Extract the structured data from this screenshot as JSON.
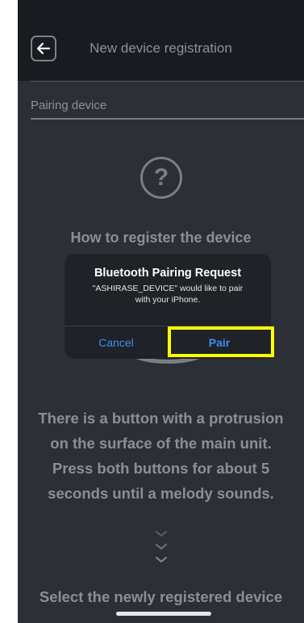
{
  "header": {
    "title": "New device registration",
    "back_icon": "arrow-left-icon"
  },
  "section": {
    "label": "Pairing device"
  },
  "help": {
    "icon_char": "?",
    "title": "How to register the device"
  },
  "instructions": {
    "lines": [
      "There is a button with a protrusion",
      "on the surface of the main unit.",
      "Press both buttons for about 5",
      "seconds until a melody sounds."
    ],
    "next_step": "Select the newly registered device"
  },
  "dialog": {
    "title": "Bluetooth Pairing Request",
    "message_line1": "\"ASHIRASE_DEVICE\" would like to pair",
    "message_line2": "with your iPhone.",
    "cancel_label": "Cancel",
    "pair_label": "Pair"
  },
  "colors": {
    "background": "#2c3036",
    "header_background": "#181b1f",
    "dialog_background": "#1f2226",
    "button_blue": "#3d8df5",
    "highlight": "#ffff00"
  }
}
